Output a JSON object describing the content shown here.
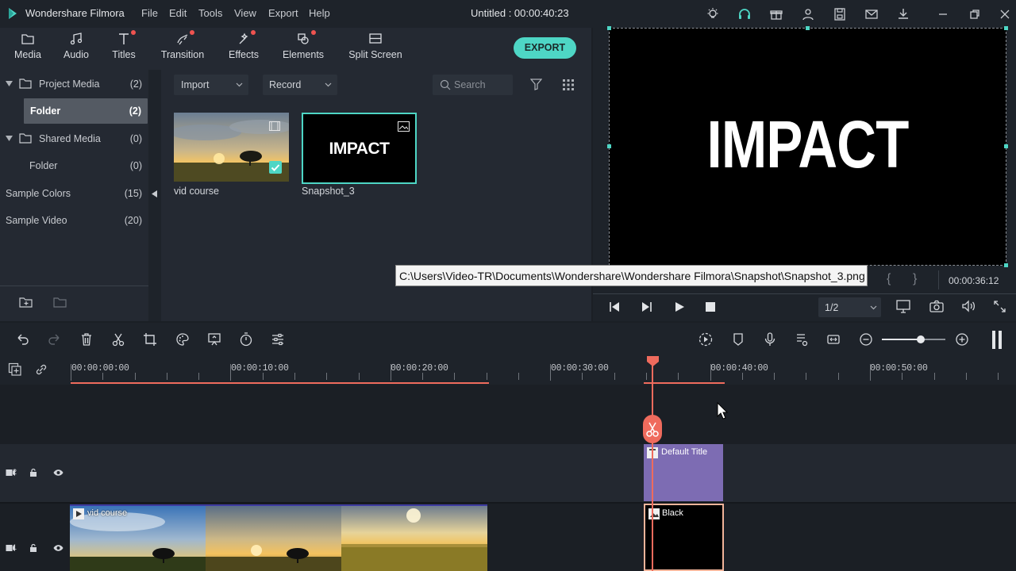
{
  "app": {
    "name": "Wondershare Filmora",
    "project_title": "Untitled : 00:00:40:23",
    "menus": [
      "File",
      "Edit",
      "Tools",
      "View",
      "Export",
      "Help"
    ]
  },
  "toolbar_tabs": [
    {
      "label": "Media",
      "icon": "folder-icon"
    },
    {
      "label": "Audio",
      "icon": "music-note-icon"
    },
    {
      "label": "Titles",
      "icon": "text-t-icon"
    },
    {
      "label": "Transition",
      "icon": "transition-icon"
    },
    {
      "label": "Effects",
      "icon": "effects-icon"
    },
    {
      "label": "Elements",
      "icon": "elements-icon"
    },
    {
      "label": "Split Screen",
      "icon": "split-screen-icon"
    }
  ],
  "export_label": "EXPORT",
  "sidebar": {
    "items": [
      {
        "label": "Project Media",
        "count": "(2)"
      },
      {
        "label": "Folder",
        "count": "(2)"
      },
      {
        "label": "Shared Media",
        "count": "(0)"
      },
      {
        "label": "Folder",
        "count": "(0)"
      },
      {
        "label": "Sample Colors",
        "count": "(15)"
      },
      {
        "label": "Sample Video",
        "count": "(20)"
      }
    ]
  },
  "media_toolbar": {
    "import_label": "Import",
    "record_label": "Record",
    "search_placeholder": "Search"
  },
  "media_items": [
    {
      "name": "vid course"
    },
    {
      "name": "Snapshot_3",
      "thumb_text": "IMPACT"
    }
  ],
  "preview": {
    "text": "IMPACT",
    "timecode": "00:00:36:12",
    "quality": "1/2",
    "brace_open": "{",
    "brace_close": "}"
  },
  "tooltip": "C:\\Users\\Video-TR\\Documents\\Wondershare\\Wondershare Filmora\\Snapshot\\Snapshot_3.png",
  "timeline": {
    "ruler_labels": [
      "00:00:00:00",
      "00:00:10:00",
      "00:00:20:00",
      "00:00:30:00",
      "00:00:40:00",
      "00:00:50:00"
    ],
    "tracks": [
      {
        "label": "2"
      },
      {
        "label": "1"
      }
    ],
    "clips": {
      "title": "Default Title",
      "black": "Black",
      "video": "vid course"
    }
  },
  "colors": {
    "accent": "#4ed6c5",
    "playhead": "#ef6b5d",
    "title_clip": "#7d6cb3"
  }
}
